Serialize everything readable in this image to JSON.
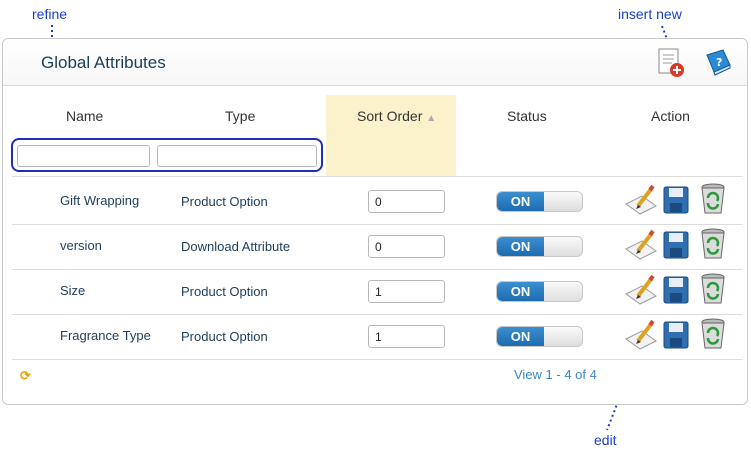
{
  "callouts": {
    "refine": "refine",
    "insert_new": "insert new",
    "edit": "edit"
  },
  "panel": {
    "title": "Global Attributes",
    "icons": [
      "insert-new-icon",
      "help-icon"
    ]
  },
  "columns": {
    "name": "Name",
    "type": "Type",
    "sort_order": "Sort Order",
    "status": "Status",
    "action": "Action"
  },
  "filters": {
    "name_value": "",
    "type_value": ""
  },
  "rows": [
    {
      "name": "Gift Wrapping",
      "type": "Product Option",
      "sort_order": "0",
      "status": "ON"
    },
    {
      "name": "version",
      "type": "Download Attribute",
      "sort_order": "0",
      "status": "ON"
    },
    {
      "name": "Size",
      "type": "Product Option",
      "sort_order": "1",
      "status": "ON"
    },
    {
      "name": "Fragrance Type",
      "type": "Product Option",
      "sort_order": "1",
      "status": "ON"
    }
  ],
  "row_actions": [
    "edit-icon",
    "save-icon",
    "delete-icon"
  ],
  "footer": {
    "pager": "View 1 - 4 of 4",
    "refresh_glyph": "⟳"
  },
  "colors": {
    "accent": "#1d6bb0",
    "callout": "#1a3fc4",
    "sort_highlight": "#fbf2cc",
    "link": "#3a87c8"
  }
}
